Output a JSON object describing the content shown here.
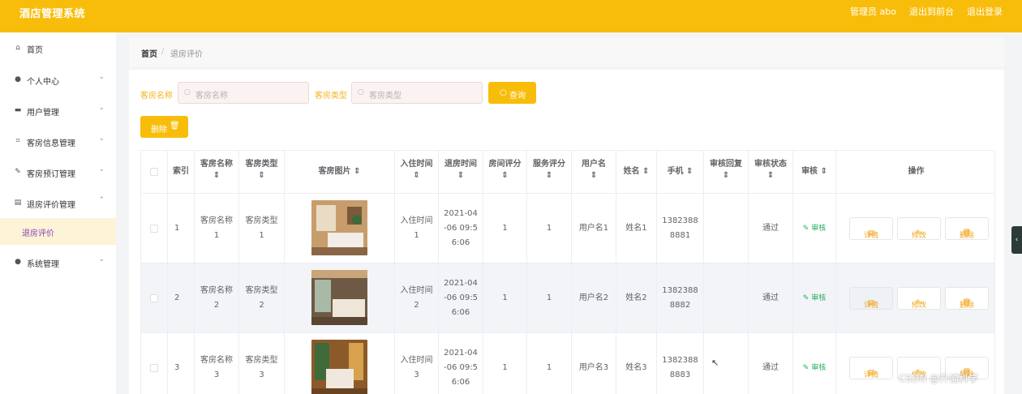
{
  "header": {
    "title": "酒店管理系统",
    "admin": "管理员 abo",
    "to_front": "退出到前台",
    "logout": "退出登录"
  },
  "sidebar": {
    "items": [
      {
        "label": "首页",
        "icon": "home-icon"
      },
      {
        "label": "个人中心",
        "icon": "user-icon"
      },
      {
        "label": "用户管理",
        "icon": "chat-icon"
      },
      {
        "label": "客房信息管理",
        "icon": "crop-icon"
      },
      {
        "label": "客房预订管理",
        "icon": "edit-icon"
      },
      {
        "label": "退房评价管理",
        "icon": "briefcase-icon"
      },
      {
        "label": "系统管理",
        "icon": "location-icon"
      }
    ],
    "sub_active": "退房评价"
  },
  "breadcrumb": {
    "home": "首页",
    "separator": "/",
    "current": "退房评价"
  },
  "search": {
    "name_label": "客房名称",
    "name_placeholder": "客房名称",
    "type_label": "客房类型",
    "type_placeholder": "客房类型",
    "query_button": "查询",
    "delete_button": "删除"
  },
  "table": {
    "headers": [
      "索引",
      "客房名称",
      "客房类型",
      "客房图片",
      "入住时间",
      "退房时间",
      "房间评分",
      "服务评分",
      "用户名",
      "姓名",
      "手机",
      "审核回复",
      "审核状态",
      "审核",
      "操作"
    ],
    "rows": [
      {
        "index": "1",
        "room_name": "客房名称\n1",
        "room_type": "客房类型\n1",
        "checkin": "入住时间\n1",
        "checkout": "2021-04\n-06 09:5\n6:06",
        "room_score": "1",
        "service_score": "1",
        "username": "用户名1",
        "name": "姓名1",
        "phone": "1382388\n8881",
        "reply": "",
        "status": "通过",
        "audit": "审核"
      },
      {
        "index": "2",
        "room_name": "客房名称\n2",
        "room_type": "客房类型\n2",
        "checkin": "入住时间\n2",
        "checkout": "2021-04\n-06 09:5\n6:06",
        "room_score": "1",
        "service_score": "1",
        "username": "用户名2",
        "name": "姓名2",
        "phone": "1382388\n8882",
        "reply": "",
        "status": "通过",
        "audit": "审核"
      },
      {
        "index": "3",
        "room_name": "客房名称\n3",
        "room_type": "客房类型\n3",
        "checkin": "入住时间\n3",
        "checkout": "2021-04\n-06 09:5\n6:06",
        "room_score": "1",
        "service_score": "1",
        "username": "用户名3",
        "name": "姓名3",
        "phone": "1382388\n8883",
        "reply": "",
        "status": "通过",
        "audit": "审核"
      }
    ],
    "actions": {
      "detail": "详情",
      "edit": "修改",
      "delete": "删除"
    }
  },
  "watermark": "CSDN @升幅科学",
  "colors": {
    "brand": "#f8bd0b",
    "audit": "#27ae60",
    "active_sub": "#8a46b8"
  }
}
